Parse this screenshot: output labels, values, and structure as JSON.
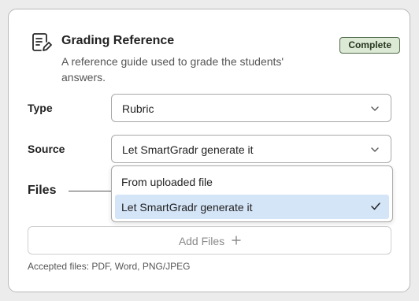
{
  "header": {
    "title": "Grading Reference",
    "description": "A reference guide used to grade the students' answers.",
    "status_badge": "Complete",
    "icon": "document-pen-icon"
  },
  "type_row": {
    "label": "Type",
    "value": "Rubric"
  },
  "source_row": {
    "label": "Source",
    "value": "Let SmartGradr generate it",
    "options": [
      {
        "label": "From uploaded file",
        "selected": false
      },
      {
        "label": "Let SmartGradr generate it",
        "selected": true
      }
    ]
  },
  "files": {
    "label": "Files",
    "add_button": "Add Files",
    "accepted": "Accepted files: PDF, Word, PNG/JPEG"
  },
  "colors": {
    "badge_bg": "#dbe9d5",
    "selected_option_bg": "#d5e5f8"
  }
}
